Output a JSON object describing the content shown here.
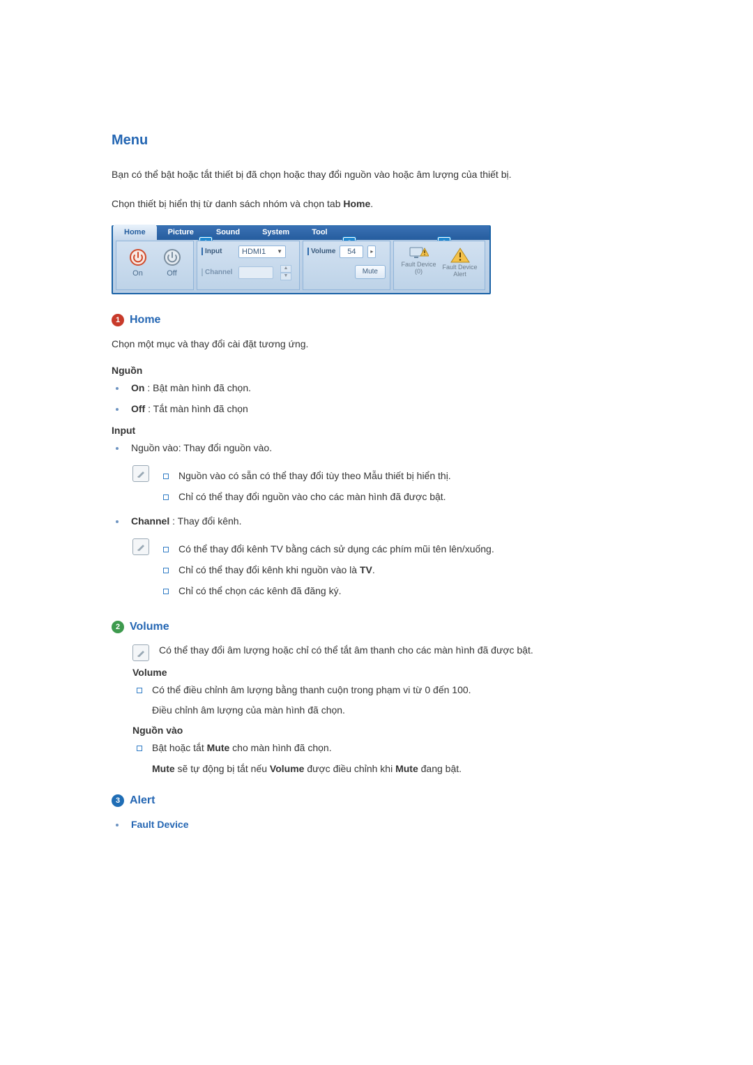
{
  "title": "Menu",
  "intro1": "Bạn có thể bật hoặc tắt thiết bị đã chọn hoặc thay đổi nguồn vào hoặc âm lượng của thiết bị.",
  "intro2_pre": "Chọn thiết bị hiển thị từ danh sách nhóm và chọn tab ",
  "intro2_bold": "Home",
  "intro2_post": ".",
  "app": {
    "tabs": [
      "Home",
      "Picture",
      "Sound",
      "System",
      "Tool"
    ],
    "callouts": {
      "c1": "1",
      "c2": "2",
      "c3": "3"
    },
    "power": {
      "on": "On",
      "off": "Off"
    },
    "input": {
      "lbl_input": "Input",
      "val_input": "HDMI1",
      "lbl_channel": "Channel",
      "val_channel": ""
    },
    "volume": {
      "lbl": "Volume",
      "val": "54",
      "mute": "Mute"
    },
    "alert": {
      "a1_l1": "Fault Device",
      "a1_l2": "(0)",
      "a2_l1": "Fault Device",
      "a2_l2": "Alert"
    }
  },
  "sec1": {
    "num": "1",
    "title": "Home",
    "desc": "Chọn một mục và thay đổi cài đặt tương ứng.",
    "nguon_h": "Nguồn",
    "on_b": "On",
    "on_t": " : Bật màn hình đã chọn.",
    "off_b": "Off",
    "off_t": " : Tắt màn hình đã chọn",
    "input_h": "Input",
    "input_li1": "Nguồn vào: Thay đổi nguồn vào.",
    "input_sub1": "Nguồn vào có sẵn có thể thay đổi tùy theo Mẫu thiết bị hiển thị.",
    "input_sub2": "Chỉ có thể thay đổi nguồn vào cho các màn hình đã được bật.",
    "channel_b": "Channel",
    "channel_t": " : Thay đổi kênh.",
    "ch_sub1": "Có thể thay đổi kênh TV bằng cách sử dụng các phím mũi tên lên/xuống.",
    "ch_sub2_pre": "Chỉ có thể thay đổi kênh khi nguồn vào là ",
    "ch_sub2_b": "TV",
    "ch_sub2_post": ".",
    "ch_sub3": "Chỉ có thể chọn các kênh đã đăng ký."
  },
  "sec2": {
    "num": "2",
    "title": "Volume",
    "note": "Có thể thay đổi âm lượng hoặc chỉ có thể tắt âm thanh cho các màn hình đã được bật.",
    "vol_h": "Volume",
    "vol_li1": "Có thể điều chỉnh âm lượng bằng thanh cuộn trong phạm vi từ 0 đến 100.",
    "vol_li2": "Điều chỉnh âm lượng của màn hình đã chọn.",
    "ngvao_h": "Nguồn vào",
    "ng_li1_pre": "Bật hoặc tắt ",
    "ng_li1_b": "Mute",
    "ng_li1_post": " cho màn hình đã chọn.",
    "ng_li2_b1": "Mute",
    "ng_li2_m1": " sẽ tự động bị tắt nếu ",
    "ng_li2_b2": "Volume",
    "ng_li2_m2": " được điều chỉnh khi ",
    "ng_li2_b3": "Mute",
    "ng_li2_m3": " đang bật."
  },
  "sec3": {
    "num": "3",
    "title": "Alert",
    "item": "Fault Device"
  }
}
